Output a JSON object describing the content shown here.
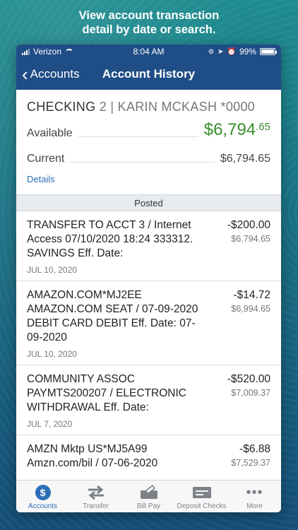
{
  "headline": [
    "View account transaction",
    "detail by date or search."
  ],
  "status_bar": {
    "carrier": "Verizon",
    "time": "8:04 AM",
    "battery": "99%",
    "battery_level": 0.99
  },
  "nav": {
    "back_label": "Accounts",
    "title": "Account History"
  },
  "account": {
    "name": "CHECKING",
    "number_suffix": "2",
    "owner": "| KARIN MCKASH *0000",
    "available_label": "Available",
    "available_dollars": "$6,794",
    "available_cents": ".65",
    "current_label": "Current",
    "current_amount": "$6,794.65",
    "details_link": "Details"
  },
  "section_header": "Posted",
  "transactions": [
    {
      "description": "TRANSFER TO ACCT 3 / Internet Access 07/10/2020 18:24 333312. SAVINGS Eff. Date:",
      "date": "JUL 10, 2020",
      "amount": "-$200.00",
      "balance": "$6,794.65"
    },
    {
      "description": "AMAZON.COM*MJ2EE AMAZON.COM SEAT / 07-09-2020 DEBIT CARD DEBIT Eff. Date: 07-09-2020",
      "date": "JUL 10, 2020",
      "amount": "-$14.72",
      "balance": "$6,994.65"
    },
    {
      "description": "COMMUNITY ASSOC PAYMTS200207 / ELECTRONIC WITHDRAWAL Eff. Date:",
      "date": "JUL 7, 2020",
      "amount": "-$520.00",
      "balance": "$7,009.37"
    },
    {
      "description": "AMZN Mktp US*MJ5A99 Amzn.com/bil / 07-06-2020",
      "date": "",
      "amount": "-$6.88",
      "balance": "$7,529.37"
    }
  ],
  "tabs": [
    {
      "label": "Accounts",
      "icon": "dollar-coin-icon",
      "active": true
    },
    {
      "label": "Transfer",
      "icon": "transfer-arrows-icon",
      "active": false
    },
    {
      "label": "Bill Pay",
      "icon": "bill-pay-icon",
      "active": false
    },
    {
      "label": "Deposit Checks",
      "icon": "check-card-icon",
      "active": false
    },
    {
      "label": "More",
      "icon": "more-dots-icon",
      "active": false
    }
  ],
  "colors": {
    "nav_blue": "#1f4d86",
    "accent_blue": "#2a6fb5",
    "available_green": "#3a8f2e"
  }
}
